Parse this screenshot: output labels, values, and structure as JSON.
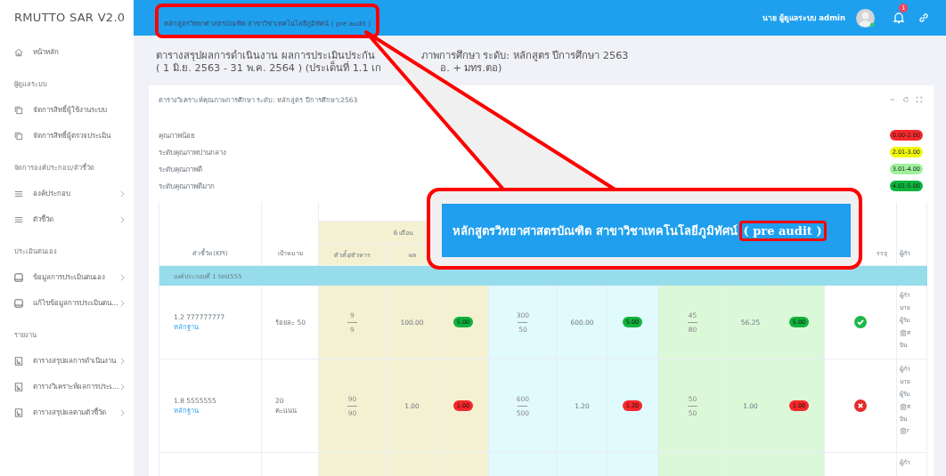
{
  "sidebar": {
    "logo": "RMUTTO SAR V2.0",
    "items": [
      {
        "kind": "home",
        "label": "หน้าหลัก",
        "has_children": false
      },
      {
        "kind": "heading",
        "label": "ผู้ดูแลระบบ"
      },
      {
        "kind": "copy",
        "label": "จัดการสิทธิ์ผู้ใช้งานระบบ",
        "has_children": false
      },
      {
        "kind": "copy",
        "label": "จัดการสิทธิ์ผู้ตรวจประเมิน",
        "has_children": false
      },
      {
        "kind": "heading",
        "label": "จัดการองค์ประกอบ/ตัวชี้วัด"
      },
      {
        "kind": "menu",
        "label": "องค์ประกอบ",
        "has_children": true
      },
      {
        "kind": "menu",
        "label": "ตัวชี้วัด",
        "has_children": true
      },
      {
        "kind": "heading",
        "label": "ประเมินตนเอง"
      },
      {
        "kind": "tablet",
        "label": "ข้อมูลการประเมินตนเอง",
        "has_children": true
      },
      {
        "kind": "tablet",
        "label": "แก้ไขข้อมูลการประเมินตน...",
        "has_children": true
      },
      {
        "kind": "heading",
        "label": "รายงาน"
      },
      {
        "kind": "report",
        "label": "ตารางสรุปผลการดำเนินงาน",
        "has_children": true
      },
      {
        "kind": "report",
        "label": "ตารางวิเคราะห์ผลการประเ...",
        "has_children": true
      },
      {
        "kind": "report",
        "label": "ตารางสรุปผลตามตัวชี้วัด",
        "has_children": true
      }
    ]
  },
  "topbar": {
    "program": "หลักสูตรวิทยาศาสตรบัณฑิต สาขาวิชาเทคโนโลยีภูมิทัศน์ ( pre audit )",
    "user": "นาย ผู้ดูแลระบบ admin",
    "notifications": "1"
  },
  "page_title": {
    "line1": [
      "ตารางสรุปผลการดำเนินงาน ผลการประเมินประกัน",
      "ภาพการศึกษา ระดับ: หลักสูตร ปีการศึกษา 2563"
    ],
    "line2": [
      "( 1 มิ.ย. 2563 - 31 พ.ค. 2564 ) (ประเด็นที่ 1.1 เก",
      "อ. + มทร.ตอ)"
    ]
  },
  "card": {
    "title": "ตารางวิเคราะห์คุณภาพการศึกษา ระดับ: หลักสูตร ปีการศึกษา:2563",
    "legend": [
      {
        "label": "คุณภาพน้อย",
        "range": "0.00-2.00",
        "color": "#f5272b"
      },
      {
        "label": "ระดับคุณภาพปานกลาง",
        "range": "2.01-3.00",
        "color": "#eef70c"
      },
      {
        "label": "ระดับคุณภาพดี",
        "range": "3.01-4.00",
        "color": "#9ef29b"
      },
      {
        "label": "ระดับคุณภาพดีมาก",
        "range": "4.01-5.00",
        "color": "#0bb53d"
      }
    ]
  },
  "table": {
    "kpi_header": "ตัวชี้วัด(KPI)",
    "target_header": "เป้าหมาย",
    "group_header": "6 เดือน",
    "sub_headers": [
      "ตัวตั้ง/ตัวหาร",
      "ผล"
    ],
    "status_header": "รรจุ",
    "last_header": "ผู้กำ",
    "component": "องค์ประกอบที่ 1 test555",
    "rows": [
      {
        "kpi": "1.2 777777777",
        "link": "หลักฐาน",
        "target": [
          "ร้อยละ 50"
        ],
        "periods": [
          {
            "numerator": "9",
            "denominator": "9",
            "result": "100.00",
            "score": "5.00",
            "color": "#10b23c"
          },
          {
            "numerator": "300",
            "denominator": "50",
            "result": "600.00",
            "score": "5.00",
            "color": "#10b23c"
          },
          {
            "numerator": "45",
            "denominator": "80",
            "result": "56.25",
            "score": "5.00",
            "color": "#10b23c"
          }
        ],
        "passed": true,
        "notes": [
          {
            "kind": "text",
            "text": "ผู้กำ"
          },
          {
            "kind": "text",
            "text": "นาย"
          },
          {
            "kind": "text",
            "text": "ผู้รับ"
          },
          {
            "kind": "building",
            "text": "ส"
          },
          {
            "kind": "text",
            "text": "บิน"
          }
        ]
      },
      {
        "kpi": "1.8 5555555",
        "link": "หลักฐาน",
        "target": [
          "20",
          "คะแนน"
        ],
        "periods": [
          {
            "numerator": "90",
            "denominator": "90",
            "result": "1.00",
            "score": "1.00",
            "color": "#f5272b"
          },
          {
            "numerator": "600",
            "denominator": "500",
            "result": "1.20",
            "score": "1.20",
            "color": "#f5272b"
          },
          {
            "numerator": "50",
            "denominator": "50",
            "result": "1.00",
            "score": "1.00",
            "color": "#f5272b"
          }
        ],
        "passed": false,
        "notes": [
          {
            "kind": "text",
            "text": "ผู้กำ"
          },
          {
            "kind": "text",
            "text": "นาย"
          },
          {
            "kind": "text",
            "text": "ผู้รับ"
          },
          {
            "kind": "building",
            "text": "ส"
          },
          {
            "kind": "text",
            "text": "บิน"
          },
          {
            "kind": "building",
            "text": "r"
          }
        ]
      },
      {
        "notes": [
          {
            "kind": "text",
            "text": "ผู้กำ"
          }
        ]
      }
    ]
  },
  "callout": {
    "text": "หลักสูตรวิทยาศาสตรบัณฑิต สาขาวิชาเทคโนโลยีภูมิทัศน์",
    "highlight": "( pre audit )"
  }
}
